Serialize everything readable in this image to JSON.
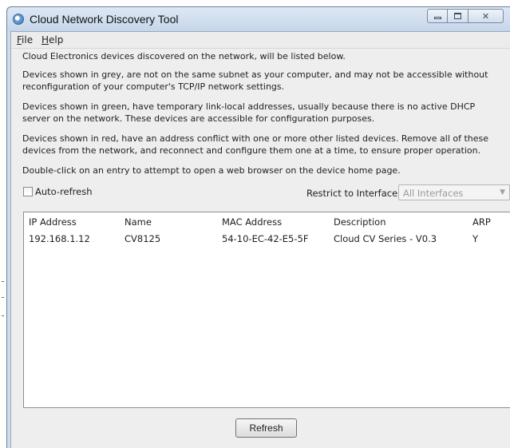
{
  "window": {
    "title": "Cloud Network Discovery Tool",
    "icon": "cloud-app-icon"
  },
  "menu": {
    "items": [
      {
        "label": "File",
        "accel": "F",
        "rest": "ile"
      },
      {
        "label": "Help",
        "accel": "H",
        "rest": "elp"
      }
    ]
  },
  "info": {
    "p1": "Cloud Electronics devices discovered on the network, will be listed below.",
    "p2": "Devices shown in grey, are not on the same subnet as your computer, and may not be accessible without reconfiguration of your computer's TCP/IP network settings.",
    "p3": "Devices shown in green, have temporary link-local addresses, usually because there is no active DHCP server on the network. These devices are accessible for configuration purposes.",
    "p4": "Devices shown in red, have an address conflict with one or more other listed devices. Remove all of these devices from the network, and reconnect and configure them one at a time, to ensure proper operation.",
    "p5": "Double-click on an entry to attempt to open a web browser on the device home page."
  },
  "controls": {
    "auto_refresh_label": "Auto-refresh",
    "auto_refresh_checked": false,
    "restrict_label": "Restrict to Interface:",
    "interface_value": "All Interfaces"
  },
  "table": {
    "columns": [
      "IP Address",
      "Name",
      "MAC Address",
      "Description",
      "ARP"
    ],
    "rows": [
      [
        "192.168.1.12",
        "CV8125",
        "54-10-EC-42-E5-5F",
        "Cloud CV Series - V0.3",
        "Y"
      ]
    ]
  },
  "actions": {
    "refresh_label": "Refresh"
  },
  "colors": {
    "titlebar": "#c6d6ea",
    "client_bg": "#eeeeee",
    "table_bg": "#ffffff"
  }
}
